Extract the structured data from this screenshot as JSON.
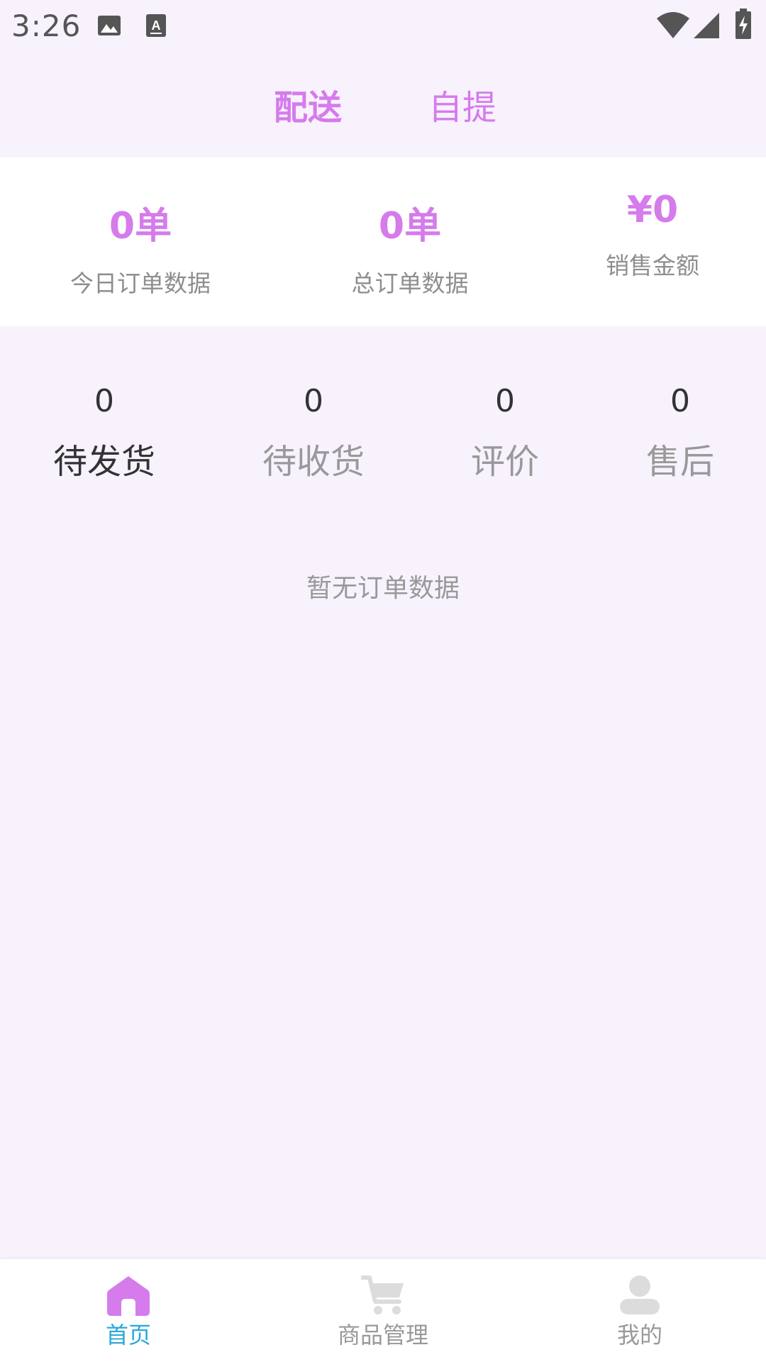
{
  "status_bar": {
    "time": "3:26",
    "icons": [
      "image-icon",
      "keyboard-a-icon",
      "wifi-icon",
      "cell-signal-icon",
      "battery-charging-icon"
    ]
  },
  "top_tabs": [
    {
      "label": "配送",
      "active": true
    },
    {
      "label": "自提",
      "active": false
    }
  ],
  "stats": [
    {
      "value": "0单",
      "label": "今日订单数据"
    },
    {
      "value": "0单",
      "label": "总订单数据"
    },
    {
      "value": "¥0",
      "label": "销售金额"
    }
  ],
  "order_status": [
    {
      "count": "0",
      "label": "待发货",
      "active": true
    },
    {
      "count": "0",
      "label": "待收货",
      "active": false
    },
    {
      "count": "0",
      "label": "评价",
      "active": false
    },
    {
      "count": "0",
      "label": "售后",
      "active": false
    }
  ],
  "empty_text": "暂无订单数据",
  "bottom_nav": [
    {
      "label": "首页",
      "icon": "home-icon",
      "active": true
    },
    {
      "label": "商品管理",
      "icon": "cart-icon",
      "active": false
    },
    {
      "label": "我的",
      "icon": "user-icon",
      "active": false
    }
  ],
  "colors": {
    "accent": "#d57bec",
    "active_nav": "#2aa8d8",
    "background": "#f8f2fd",
    "muted_text": "#999999"
  }
}
